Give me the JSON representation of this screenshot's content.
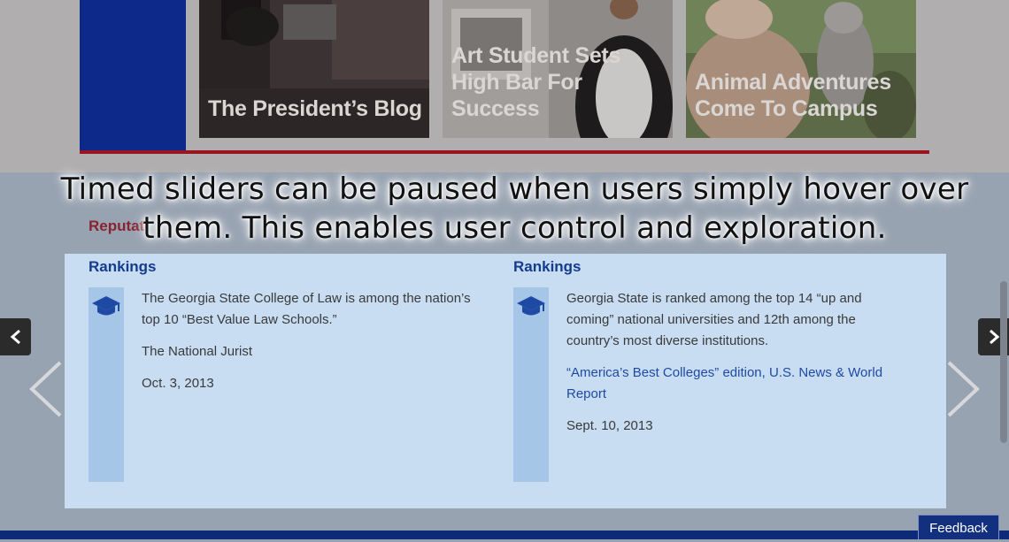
{
  "tiles": [
    {
      "lines": [
        "The President’s Blog"
      ]
    },
    {
      "lines": [
        "Art Student Sets",
        "High Bar For Success"
      ]
    },
    {
      "lines": [
        "Animal Adventures",
        "Come To Campus"
      ]
    }
  ],
  "section": {
    "title": "Reputati"
  },
  "overlay": {
    "line1": "Timed sliders can be paused when users simply hover over",
    "line2": "them. This enables user control and exploration."
  },
  "cards": [
    {
      "heading": "Rankings",
      "icon": "graduation-cap-icon",
      "text": "The Georgia State College of Law is among the nation’s top 10 “Best Value Law Schools.”",
      "source": "The National Jurist",
      "source_is_link": false,
      "date": "Oct. 3, 2013"
    },
    {
      "heading": "Rankings",
      "icon": "graduation-cap-icon",
      "text": "Georgia State is ranked among the top 14 “up and coming” national universities and 12th among the country’s most diverse institutions.",
      "source": "“America’s Best Colleges” edition, U.S. News & World Report",
      "source_is_link": true,
      "date": "Sept. 10, 2013"
    }
  ],
  "controls": {
    "prev_icon": "chevron-left-icon",
    "next_icon": "chevron-right-icon"
  },
  "feedback": {
    "label": "Feedback"
  },
  "colors": {
    "brand_blue": "#0d2a8a",
    "brand_red": "#9a1524",
    "heading_blue": "#143c8c",
    "panel": "#c8ddf2"
  }
}
